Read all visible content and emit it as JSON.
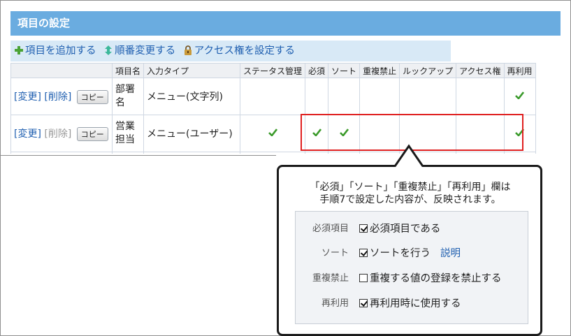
{
  "header": {
    "title": "項目の設定"
  },
  "toolbar": {
    "add_label": "項目を追加する",
    "order_label": "順番変更する",
    "access_label": "アクセス権を設定する"
  },
  "table": {
    "columns": [
      "",
      "項目名",
      "入力タイプ",
      "ステータス管理",
      "必須",
      "ソート",
      "重複禁止",
      "ルックアップ",
      "アクセス権",
      "再利用"
    ],
    "rows": [
      {
        "change": "[変更]",
        "delete": "[削除]",
        "copy": "コピー",
        "name": "部署名",
        "type": "メニュー(文字列)",
        "status": false,
        "required": false,
        "sort": false,
        "dup": false,
        "lookup": false,
        "access": false,
        "reuse": true
      },
      {
        "change": "[変更]",
        "delete": "[削除]",
        "copy": "コピー",
        "name": "営業担当",
        "type": "メニュー(ユーザー)",
        "status": true,
        "required": true,
        "sort": true,
        "dup": false,
        "lookup": false,
        "access": false,
        "reuse": true
      }
    ]
  },
  "callout": {
    "line1": "「必須」「ソート」「重複禁止」「再利用」欄は",
    "line2": "手順7で設定した内容が、反映されます。"
  },
  "panel": {
    "rows": [
      {
        "label": "必須項目",
        "value": "必須項目である",
        "checked": true
      },
      {
        "label": "ソート",
        "value": "ソートを行う",
        "checked": true,
        "link": "説明"
      },
      {
        "label": "重複禁止",
        "value": "重複する値の登録を禁止する",
        "checked": false
      },
      {
        "label": "再利用",
        "value": "再利用時に使用する",
        "checked": true
      }
    ]
  },
  "colors": {
    "header_bg": "#6aace0",
    "toolbar_bg": "#d8e9f6",
    "check_green": "#3a9a2a",
    "highlight_red": "#e02020",
    "link_blue": "#1f5fb0"
  },
  "icons": {
    "add": "plus-icon",
    "order": "updown-arrow-icon",
    "access": "lock-icon",
    "check": "check-icon"
  }
}
